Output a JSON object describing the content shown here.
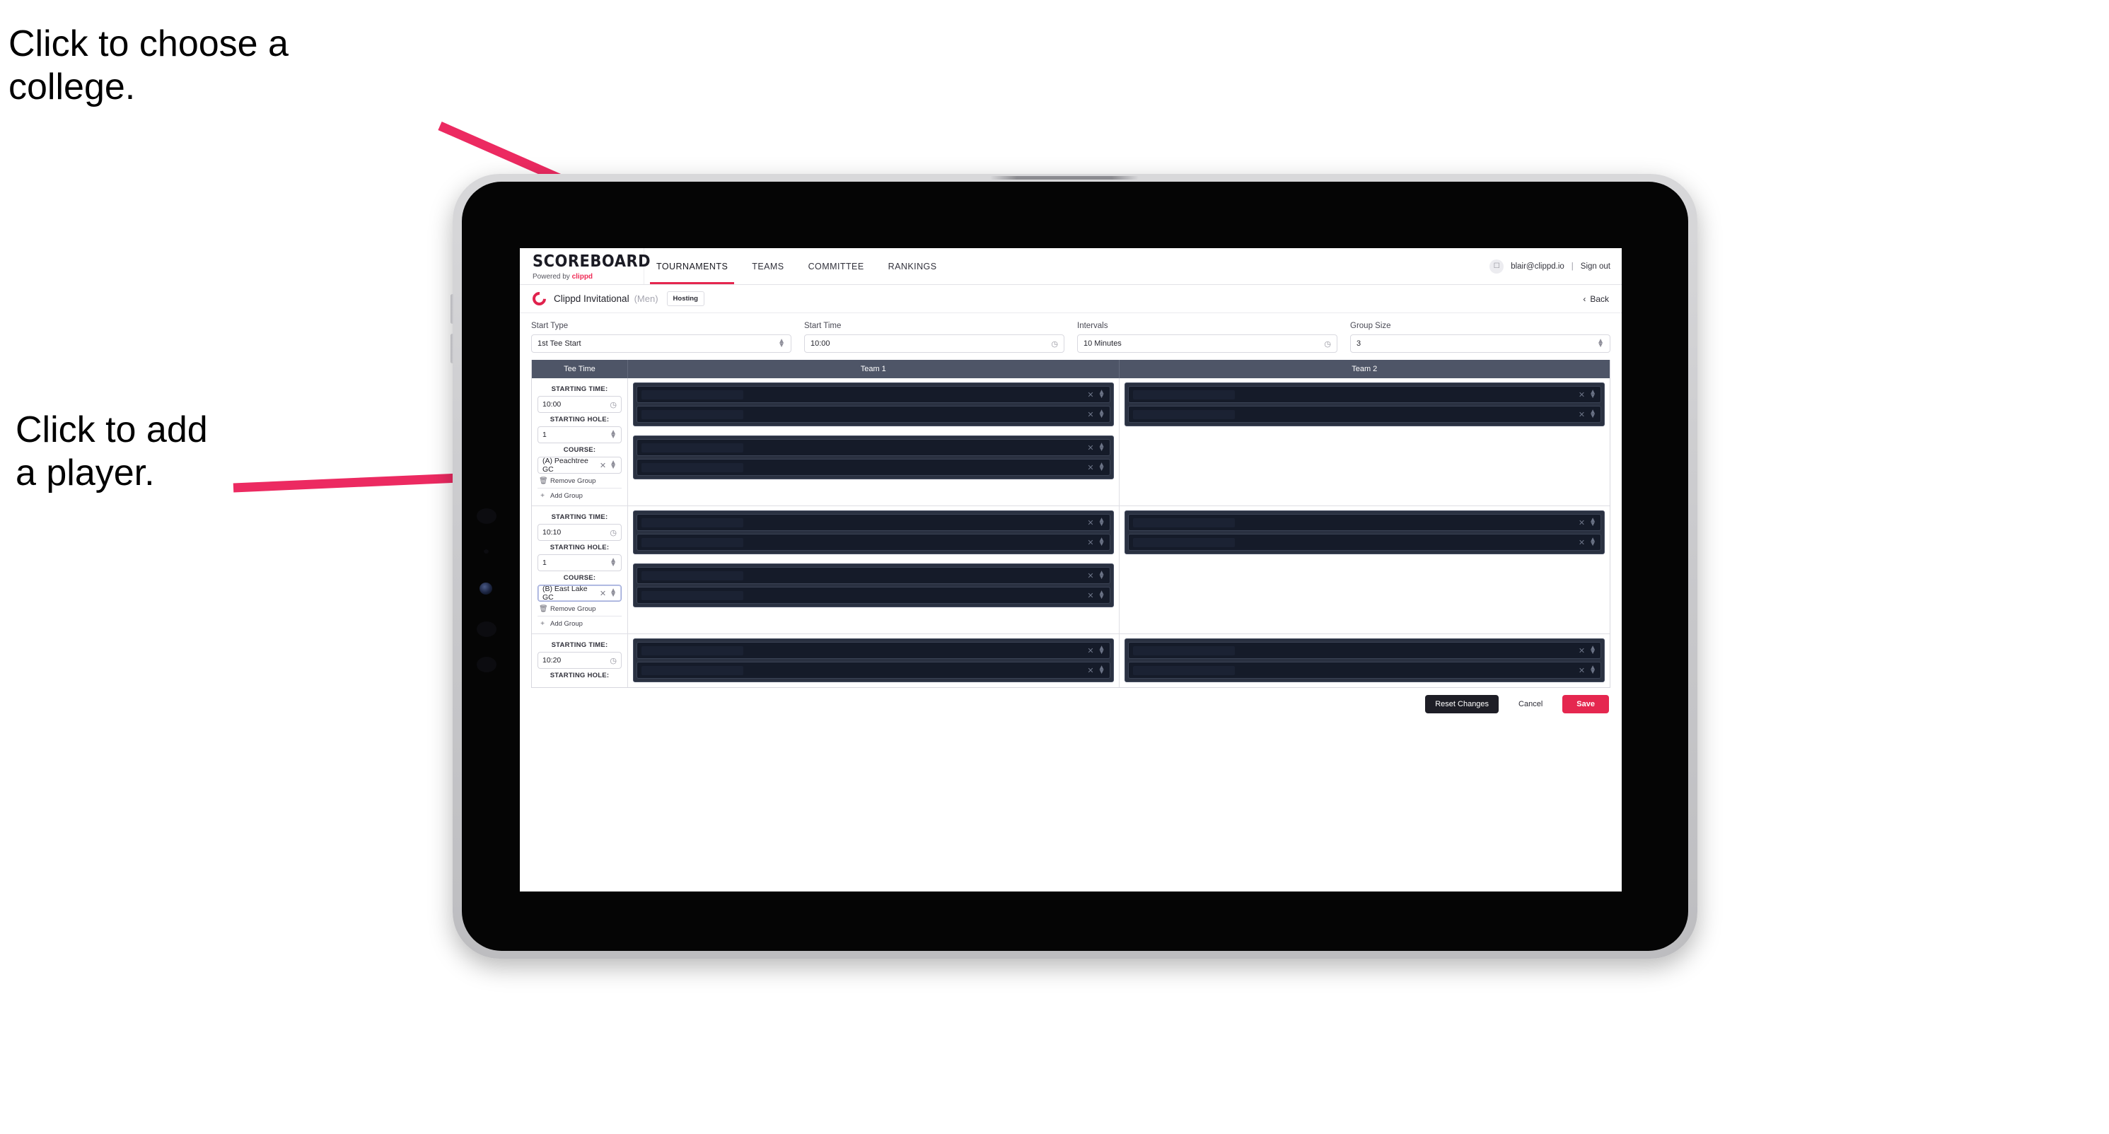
{
  "annotations": [
    {
      "id": "college",
      "text": "Click to choose a\ncollege."
    },
    {
      "id": "player",
      "text": "Click to add\na player."
    }
  ],
  "colors": {
    "accent": "#e5274f",
    "brand_pink": "#ef2b56",
    "table_header": "#4e5567",
    "dark_panel": "#2a3141",
    "dark_row": "#151b29"
  },
  "app": {
    "brand": {
      "wordmark": "SCOREBOARD",
      "powered_prefix": "Powered by ",
      "powered_brand": "clippd"
    },
    "nav": [
      {
        "label": "TOURNAMENTS",
        "active": true
      },
      {
        "label": "TEAMS",
        "active": false
      },
      {
        "label": "COMMITTEE",
        "active": false
      },
      {
        "label": "RANKINGS",
        "active": false
      }
    ],
    "user": {
      "avatar_icon": "user-avatar-icon",
      "email": "blair@clippd.io",
      "separator": "|",
      "sign_out": "Sign out"
    },
    "tournament": {
      "logo_icon": "clippd-c-logo-icon",
      "name": "Clippd Invitational",
      "gender": "(Men)",
      "badge": "Hosting",
      "back_label": "Back",
      "back_icon": "chevron-left-icon"
    },
    "controls": [
      {
        "label": "Start Type",
        "value": "1st Tee Start",
        "icon": "stepper-up-down-icon"
      },
      {
        "label": "Start Time",
        "value": "10:00",
        "icon": "clock-icon"
      },
      {
        "label": "Intervals",
        "value": "10 Minutes",
        "icon": "clock-icon"
      },
      {
        "label": "Group Size",
        "value": "3",
        "icon": "stepper-up-down-icon"
      }
    ],
    "table": {
      "headers": [
        "Tee Time",
        "Team 1",
        "Team 2"
      ],
      "field_labels": {
        "time": "STARTING TIME:",
        "hole": "STARTING HOLE:",
        "course": "COURSE:"
      },
      "group_actions": {
        "remove": "Remove Group",
        "add": "Add Group",
        "remove_icon": "trash-icon",
        "add_icon": "plus-icon"
      },
      "row_icons": {
        "clear": "clear-x-icon",
        "stepper": "stepper-up-down-icon",
        "clock": "clock-icon"
      },
      "rows": [
        {
          "starting_time": "10:00",
          "starting_hole": "1",
          "course": "(A) Peachtree GC",
          "course_focused": false,
          "team1_groups": [
            {
              "players": [
                "",
                ""
              ]
            },
            {
              "players": [
                "",
                ""
              ]
            }
          ],
          "team2_groups": [
            {
              "players": [
                "",
                ""
              ]
            }
          ]
        },
        {
          "starting_time": "10:10",
          "starting_hole": "1",
          "course": "(B) East Lake GC",
          "course_focused": true,
          "team1_groups": [
            {
              "players": [
                "",
                ""
              ]
            },
            {
              "players": [
                "",
                ""
              ]
            }
          ],
          "team2_groups": [
            {
              "players": [
                "",
                ""
              ]
            }
          ]
        },
        {
          "starting_time": "10:20",
          "starting_hole": "",
          "course": "",
          "course_focused": false,
          "team1_groups": [
            {
              "players": [
                "",
                ""
              ]
            }
          ],
          "team2_groups": [
            {
              "players": [
                "",
                ""
              ]
            }
          ]
        }
      ]
    },
    "footer": {
      "reset": "Reset Changes",
      "cancel": "Cancel",
      "save": "Save"
    }
  }
}
